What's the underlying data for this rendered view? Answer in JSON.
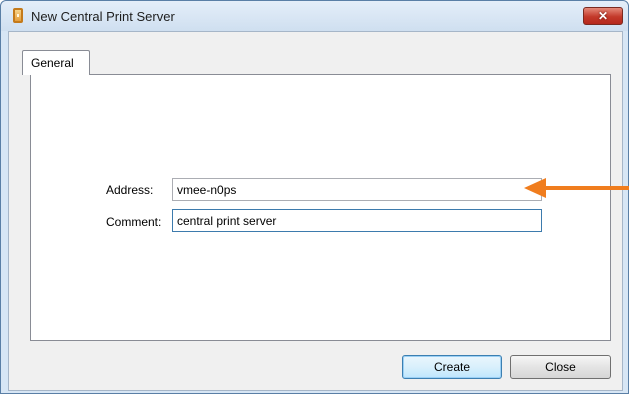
{
  "window": {
    "title": "New Central Print Server",
    "close_glyph": "✕",
    "icon": "print-server-icon"
  },
  "tabs": [
    {
      "label": "General",
      "selected": true
    }
  ],
  "form": {
    "address": {
      "label": "Address:",
      "value": "vmee-n0ps"
    },
    "comment": {
      "label": "Comment:",
      "value": "central print server"
    }
  },
  "buttons": {
    "create_label": "Create",
    "close_label": "Close"
  },
  "annotation": {
    "icon": "arrow-left-icon",
    "color": "#f07d1e"
  }
}
